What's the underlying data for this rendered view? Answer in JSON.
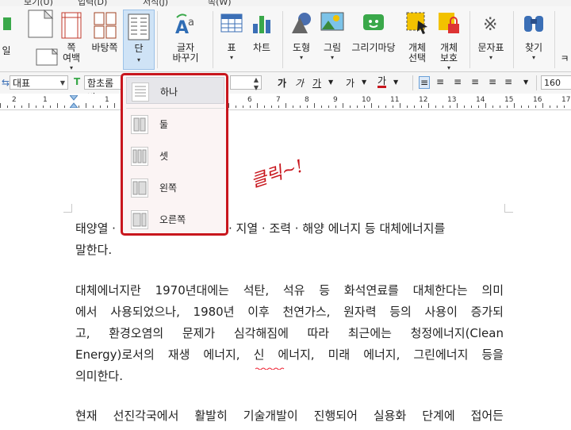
{
  "menu": {
    "items": [
      "보기(U)",
      "입력(D)",
      "서식(J)",
      "쪽(W)"
    ]
  },
  "ribbon": {
    "partial_left_label": "일",
    "margin_button": "쪽\n여백",
    "background_button": "바탕쪽",
    "columns_button": "단",
    "text_change_button": "글자\n바꾸기",
    "table_button": "표",
    "chart_button": "차트",
    "shape_button": "도형",
    "picture_button": "그림",
    "clipart_button": "그리기마당",
    "object_select_button": "개체\n선택",
    "object_protect_button": "개체\n보호",
    "symbol_button": "문자표",
    "find_button": "찾기",
    "partial_right_label": "ㅋ"
  },
  "format_bar": {
    "style": "대표",
    "font": "함초롬바",
    "font_size": "160"
  },
  "ruler": {
    "numbers": [
      "2",
      "1",
      "1",
      "2",
      "3",
      "4",
      "5",
      "6",
      "7",
      "8",
      "9",
      "10",
      "11",
      "12",
      "13",
      "14",
      "15",
      "16",
      "17"
    ]
  },
  "columns_menu": {
    "items": [
      {
        "label": "하나",
        "selected": true
      },
      {
        "label": "둘",
        "selected": false
      },
      {
        "label": "셋",
        "selected": false
      },
      {
        "label": "왼쪽",
        "selected": false
      },
      {
        "label": "오른쪽",
        "selected": false
      }
    ]
  },
  "annotation": {
    "text": "클릭~!",
    "color": "#c8161d"
  },
  "document": {
    "p1_line1_start": "태양열 ·",
    "p1_line1_end": "· 지열 · 조력 · 해양 에너지 등 대체에너지를",
    "p1_line2": "말한다.",
    "p2_lines": [
      "대체에너지란 1970년대에는 석탄, 석유 등 화석연료를 대체한다는 의미",
      "에서 사용되었으나, 1980년 이후 천연가스, 원자력 등의 사용이 증가되",
      "고, 환경오염의 문제가 심각해짐에 따라 최근에는 청정에너지(Clean",
      "Energy)로서의 재생 에너지, 신 에너지, 미래 에너지, 그린에너지 등을",
      "의미한다."
    ],
    "p3_line1": "현재 선진각국에서 활발히 기술개발이 진행되어 실용화 단계에 접어든"
  },
  "colors": {
    "highlight_red": "#c8161d",
    "ribbon_bg": "#f7f7f7",
    "selected_blue": "#cfe3f6"
  }
}
